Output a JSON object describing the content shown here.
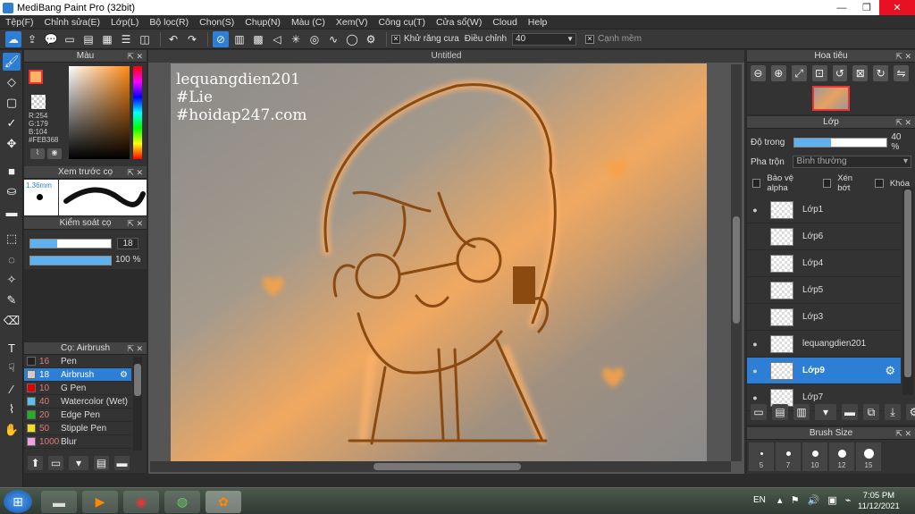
{
  "window": {
    "title": "MediBang Paint Pro (32bit)",
    "min": "—",
    "max": "❐",
    "close": "✕"
  },
  "menu": [
    "Tệp(F)",
    "Chỉnh sửa(E)",
    "Lớp(L)",
    "Bộ lọc(R)",
    "Chọn(S)",
    "Chụp(N)",
    "Màu (C)",
    "Xem(V)",
    "Công cụ(T)",
    "Cửa sổ(W)",
    "Cloud",
    "Help"
  ],
  "toolbar": {
    "antialias_label": "Khử răng cưa",
    "adjust_label": "Điều chỉnh",
    "adjust_value": "40",
    "smooth_label": "Cạnh mềm"
  },
  "color_panel": {
    "title": "Màu",
    "r": "R:254",
    "g": "G:179",
    "b": "B:104",
    "hex": "#FEB368",
    "fg_color": "#FEB368"
  },
  "brush_preview": {
    "title": "Xem trước cọ",
    "size": "1.36mm"
  },
  "brush_control": {
    "title": "Kiểm soát cọ",
    "size_value": "18",
    "opacity_value": "100 %",
    "size_fraction": 0.33,
    "opacity_fraction": 1.0
  },
  "brush_list": {
    "title": "Cọ: Airbrush",
    "items": [
      {
        "size": "16",
        "name": "Pen",
        "color": "#222222"
      },
      {
        "size": "18",
        "name": "Airbrush",
        "color": "#cccccc"
      },
      {
        "size": "10",
        "name": "G Pen",
        "color": "#e00000"
      },
      {
        "size": "40",
        "name": "Watercolor (Wet)",
        "color": "#5bc0f0"
      },
      {
        "size": "20",
        "name": "Edge Pen",
        "color": "#20b020"
      },
      {
        "size": "50",
        "name": "Stipple Pen",
        "color": "#f0e020"
      },
      {
        "size": "1000",
        "name": "Blur",
        "color": "#f0a0e0"
      }
    ]
  },
  "canvas": {
    "doc_title": "Untitled",
    "watermark": [
      "lequangdien201",
      "#Lie",
      "#hoidap247.com"
    ]
  },
  "navigator": {
    "title": "Hoa tiêu"
  },
  "layers": {
    "title": "Lớp",
    "opacity_label": "Độ trong",
    "opacity_value": "40 %",
    "opacity_fraction": 0.4,
    "blend_label": "Pha trộn",
    "blend_value": "Bình thường",
    "protect_alpha": "Bảo vệ alpha",
    "clip": "Xén bớt",
    "lock": "Khóa",
    "items": [
      {
        "name": "Lớp1",
        "visible": true
      },
      {
        "name": "Lớp6",
        "visible": false
      },
      {
        "name": "Lớp4",
        "visible": false
      },
      {
        "name": "Lớp5",
        "visible": false
      },
      {
        "name": "Lớp3",
        "visible": false
      },
      {
        "name": "lequangdien201",
        "visible": true
      },
      {
        "name": "Lớp9",
        "visible": true,
        "selected": true
      },
      {
        "name": "Lớp7",
        "visible": true
      }
    ]
  },
  "brush_size": {
    "title": "Brush Size",
    "sizes": [
      "5",
      "7",
      "10",
      "12",
      "15"
    ]
  },
  "taskbar": {
    "lang": "EN",
    "time": "7:05 PM",
    "date": "11/12/2021"
  }
}
